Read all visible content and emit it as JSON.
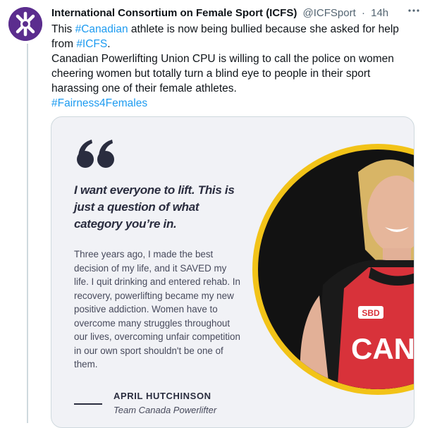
{
  "post": {
    "author_name": "International Consortium on Female Sport (ICFS)",
    "author_handle": "@ICFSport",
    "separator": "·",
    "time": "14h",
    "more_icon": "more-horizontal-icon",
    "text": {
      "line1_prefix": "This ",
      "hashtag_canadian": "#Canadian",
      "line1_suffix": " athlete is now being bullied because she asked for help from ",
      "hashtag_icfs": "#ICFS",
      "line1_end": ".",
      "paragraph2": "Canadian Powerlifting Union CPU is willing to call the police on women cheering women but totally turn a blind eye to people in their sport harassing one of their female athletes.",
      "hashtag_fairness": "#Fairness4Females"
    }
  },
  "card": {
    "headline": "I want everyone to lift. This is just a question of what category you’re in.",
    "body": "Three years ago, I made the best decision of my life, and it SAVED my life. I quit drinking and entered rehab. In recovery, powerlifting became my new positive addiction. Women have to overcome many struggles throughout our lives, overcoming unfair competition in our own sport shouldn't be one of them.",
    "signature_name": "APRIL HUTCHINSON",
    "signature_title": "Team Canada Powerlifter",
    "photo_shirt_text": "CAN",
    "photo_logo_text": "SBD"
  },
  "colors": {
    "link": "#1d9bf0",
    "avatar_bg": "#5b2d8e",
    "card_bg": "#f1f2f6",
    "quote_navy": "#2a2d3f",
    "photo_ring": "#f2c318",
    "singlet_red": "#d8323a"
  }
}
